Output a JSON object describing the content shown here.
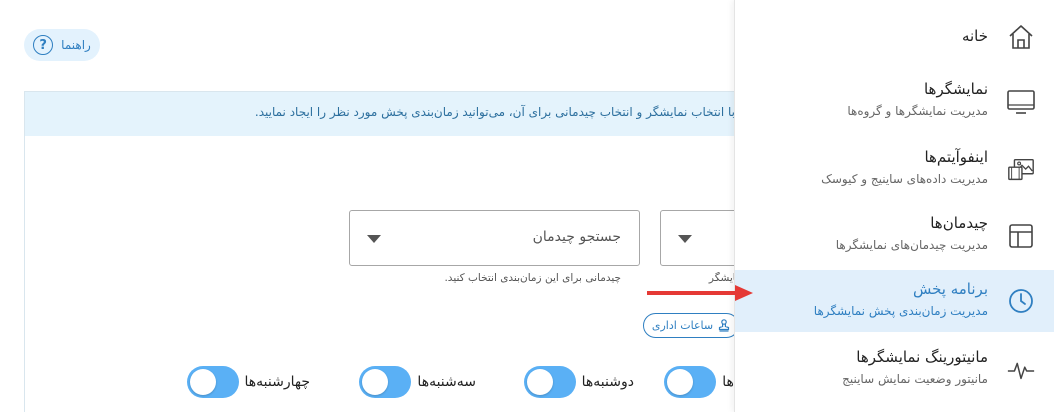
{
  "help_button": {
    "label": "راهنما",
    "icon": "question-circle-icon"
  },
  "info_bar": {
    "text": "با انتخاب نمایشگر و انتخاب چیدمانی برای آن، می‌توانید زمان‌بندی پخش مورد نظر را ایجاد نمایید."
  },
  "display_select": {
    "placeholder": "",
    "helper": "نمایشگر را انتخاب نمایید."
  },
  "layout_select": {
    "placeholder": "جستجو چیدمان",
    "helper": "چیدمانی برای این زمان‌بندی انتخاب کنید."
  },
  "office_hours_chip": {
    "label": "ساعات اداری",
    "icon": "stamp-icon"
  },
  "days": [
    {
      "label": "یکشنبه‌ها",
      "on": true
    },
    {
      "label": "دوشنبه‌ها",
      "on": true
    },
    {
      "label": "سه‌شنبه‌ها",
      "on": true
    },
    {
      "label": "چهارشنبه‌ها",
      "on": true
    }
  ],
  "sidebar": {
    "items": [
      {
        "title": "خانه",
        "subtitle": "",
        "icon": "home-icon",
        "active": false
      },
      {
        "title": "نمایشگرها",
        "subtitle": "مدیریت نمایشگرها و گروه‌ها",
        "icon": "monitor-icon",
        "active": false
      },
      {
        "title": "اینفوآیتم‌ها",
        "subtitle": "مدیریت داده‌های ساینیج و کیوسک",
        "icon": "media-gallery-icon",
        "active": false
      },
      {
        "title": "چیدمان‌ها",
        "subtitle": "مدیریت چیدمان‌های نمایشگرها",
        "icon": "layout-icon",
        "active": false
      },
      {
        "title": "برنامه پخش",
        "subtitle": "مدیریت زمان‌بندی پخش نمایشگرها",
        "icon": "clock-icon",
        "active": true
      },
      {
        "title": "مانیتورینگ نمایشگرها",
        "subtitle": "مانیتور وضعیت نمایش ساینیج",
        "icon": "pulse-icon",
        "active": false
      }
    ]
  },
  "colors": {
    "accent": "#2f7fc1",
    "toggle_on": "#5ab0f5",
    "info_bg": "#e4f3fc",
    "active_bg": "#e1effb",
    "arrow": "#e53935"
  }
}
